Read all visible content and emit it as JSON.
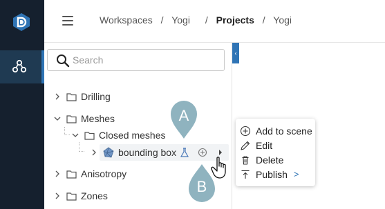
{
  "nav": {
    "logo_icon": "app-logo-icon",
    "active_item_icon": "hierarchy-icon",
    "accent_color": "#2f74b5",
    "rail_color": "#15202e"
  },
  "header": {
    "breadcrumb": [
      "Workspaces",
      "Yogi",
      "Projects",
      "Yogi"
    ],
    "separator": "/"
  },
  "search": {
    "placeholder": "Search",
    "value": ""
  },
  "tree": {
    "drilling": "Drilling",
    "meshes": "Meshes",
    "closed_meshes": "Closed meshes",
    "bounding_box": "bounding box",
    "anisotropy": "Anisotropy",
    "zones": "Zones"
  },
  "markers": {
    "a": "A",
    "b": "B",
    "color": "#8fb3bf"
  },
  "context_menu": {
    "add_to_scene": "Add to scene",
    "edit": "Edit",
    "delete": "Delete",
    "publish": "Publish",
    "submenu_arrow": ">"
  }
}
